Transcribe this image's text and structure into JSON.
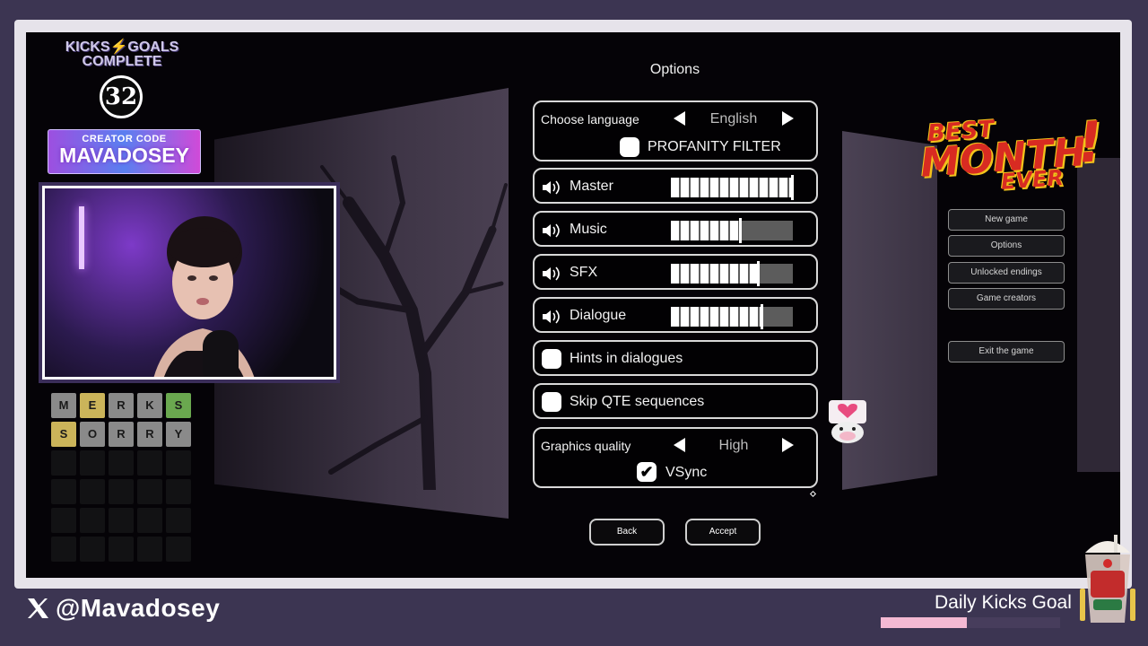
{
  "options": {
    "title": "Options",
    "language": {
      "label": "Choose language",
      "value": "English"
    },
    "profanity_filter": {
      "label": "PROFANITY FILTER",
      "checked": false
    },
    "volumes": [
      {
        "label": "Master",
        "level": 1.0
      },
      {
        "label": "Music",
        "level": 0.57
      },
      {
        "label": "SFX",
        "level": 0.72
      },
      {
        "label": "Dialogue",
        "level": 0.75
      }
    ],
    "hints": {
      "label": "Hints in dialogues",
      "checked": false
    },
    "skip_qte": {
      "label": "Skip QTE sequences",
      "checked": false
    },
    "graphics": {
      "label": "Graphics quality",
      "value": "High"
    },
    "vsync": {
      "label": "VSync",
      "checked": true,
      "mark": "✔"
    },
    "back_label": "Back",
    "accept_label": "Accept"
  },
  "main_menu": {
    "new_game": "New game",
    "options": "Options",
    "unlocked_endings": "Unlocked endings",
    "game_creators": "Game creators",
    "exit": "Exit the game"
  },
  "game_logo": {
    "line1": "BEST",
    "line2": "MONTH",
    "line3": "EVER",
    "bang": "!"
  },
  "overlay": {
    "kicks_goals_line1": "KICKS⚡GOALS",
    "kicks_goals_line2": "COMPLETE",
    "goal_count": "32",
    "creator_code_label": "CREATOR CODE",
    "creator_code": "MAVADOSEY",
    "handle": "@Mavadosey",
    "daily_kicks_goal": "Daily Kicks Goal",
    "daily_progress": 0.48,
    "wordle_rows": [
      [
        {
          "l": "M",
          "s": "gray"
        },
        {
          "l": "E",
          "s": "yellow"
        },
        {
          "l": "R",
          "s": "gray"
        },
        {
          "l": "K",
          "s": "gray"
        },
        {
          "l": "S",
          "s": "green"
        }
      ],
      [
        {
          "l": "S",
          "s": "yellow"
        },
        {
          "l": "O",
          "s": "gray"
        },
        {
          "l": "R",
          "s": "gray"
        },
        {
          "l": "R",
          "s": "gray"
        },
        {
          "l": "Y",
          "s": "gray"
        }
      ]
    ],
    "wordle_total_rows": 6
  },
  "colors": {
    "frame": "#e6e3ea",
    "background": "#3c3552",
    "accent_pink": "#f4b9d3",
    "logo_red": "#d82b22",
    "logo_yellow": "#f2c21b"
  }
}
